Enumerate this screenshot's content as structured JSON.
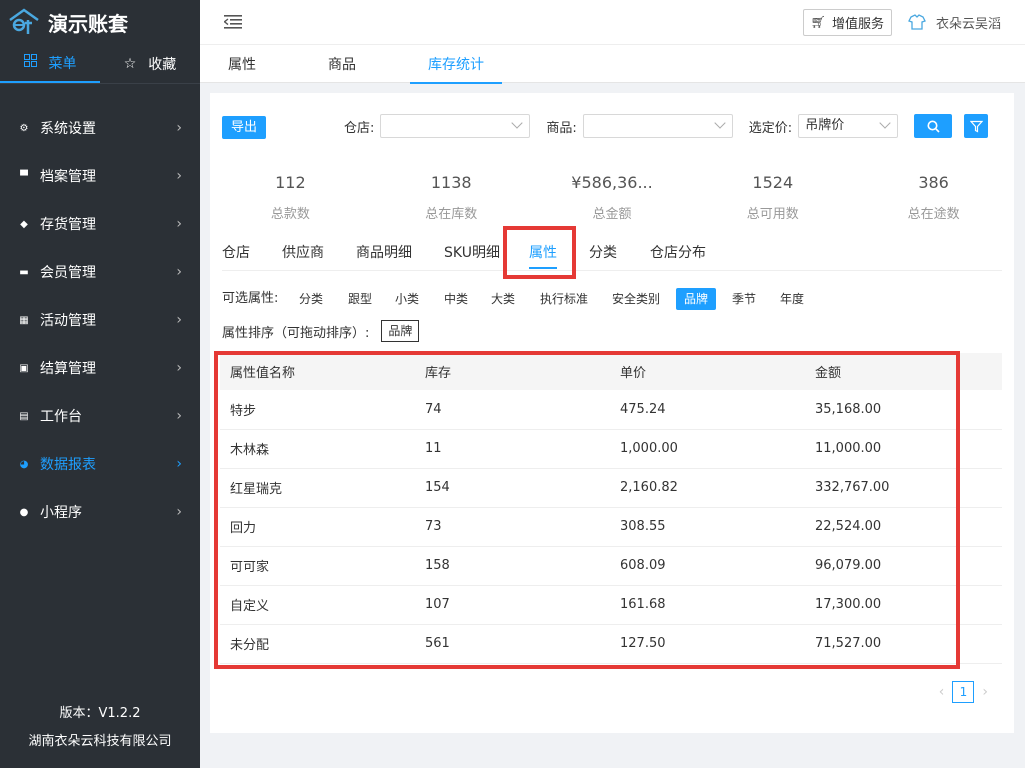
{
  "app": {
    "title": "演示账套",
    "version": "版本：V1.2.2",
    "company": "湖南衣朵云科技有限公司"
  },
  "sidebar": {
    "tabs": [
      {
        "label": "菜单",
        "icon": "grid-icon",
        "active": true
      },
      {
        "label": "收藏",
        "icon": "star-icon",
        "active": false
      }
    ],
    "items": [
      {
        "label": "系统设置",
        "icon": "settings-icon",
        "active": false
      },
      {
        "label": "档案管理",
        "icon": "archive-icon",
        "active": false
      },
      {
        "label": "存货管理",
        "icon": "box-icon",
        "active": false
      },
      {
        "label": "会员管理",
        "icon": "member-card-icon",
        "active": false
      },
      {
        "label": "活动管理",
        "icon": "gift-icon",
        "active": false
      },
      {
        "label": "结算管理",
        "icon": "wallet-icon",
        "active": false
      },
      {
        "label": "工作台",
        "icon": "workbench-icon",
        "active": false
      },
      {
        "label": "数据报表",
        "icon": "pie-chart-icon",
        "active": true
      },
      {
        "label": "小程序",
        "icon": "miniprogram-icon",
        "active": false
      }
    ]
  },
  "header": {
    "value_service": "增值服务",
    "user": "衣朵云吴滔"
  },
  "page_tabs": [
    {
      "label": "属性",
      "active": false
    },
    {
      "label": "商品",
      "active": false
    },
    {
      "label": "库存统计",
      "active": true
    }
  ],
  "filters": {
    "export_label": "导出",
    "store_label": "仓店:",
    "store_value": "",
    "product_label": "商品:",
    "product_value": "",
    "price_label": "选定价:",
    "price_value": "吊牌价"
  },
  "stats": [
    {
      "value": "112",
      "label": "总款数"
    },
    {
      "value": "1138",
      "label": "总在库数"
    },
    {
      "value": "¥586,36...",
      "label": "总金额"
    },
    {
      "value": "1524",
      "label": "总可用数"
    },
    {
      "value": "386",
      "label": "总在途数"
    }
  ],
  "sub_tabs": [
    {
      "label": "仓店",
      "active": false
    },
    {
      "label": "供应商",
      "active": false
    },
    {
      "label": "商品明细",
      "active": false
    },
    {
      "label": "SKU明细",
      "active": false
    },
    {
      "label": "属性",
      "active": true
    },
    {
      "label": "分类",
      "active": false
    },
    {
      "label": "仓店分布",
      "active": false
    }
  ],
  "attributes": {
    "label": "可选属性:",
    "items": [
      {
        "label": "分类",
        "active": false
      },
      {
        "label": "跟型",
        "active": false
      },
      {
        "label": "小类",
        "active": false
      },
      {
        "label": "中类",
        "active": false
      },
      {
        "label": "大类",
        "active": false
      },
      {
        "label": "执行标准",
        "active": false
      },
      {
        "label": "安全类别",
        "active": false
      },
      {
        "label": "品牌",
        "active": true
      },
      {
        "label": "季节",
        "active": false
      },
      {
        "label": "年度",
        "active": false
      }
    ],
    "sort_label": "属性排序（可拖动排序）:",
    "sort_chip": "品牌"
  },
  "table": {
    "headers": [
      "属性值名称",
      "库存",
      "单价",
      "金额"
    ],
    "rows": [
      [
        "特步",
        "74",
        "475.24",
        "35,168.00"
      ],
      [
        "木林森",
        "11",
        "1,000.00",
        "11,000.00"
      ],
      [
        "红星瑞克",
        "154",
        "2,160.82",
        "332,767.00"
      ],
      [
        "回力",
        "73",
        "308.55",
        "22,524.00"
      ],
      [
        "可可家",
        "158",
        "608.09",
        "96,079.00"
      ],
      [
        "自定义",
        "107",
        "161.68",
        "17,300.00"
      ],
      [
        "未分配",
        "561",
        "127.50",
        "71,527.00"
      ]
    ]
  },
  "pager": {
    "current": "1",
    "prev": "‹",
    "next": "›"
  },
  "colors": {
    "accent": "#1e9fff",
    "sidebar_bg": "#2b3036",
    "highlight": "#e53935"
  }
}
